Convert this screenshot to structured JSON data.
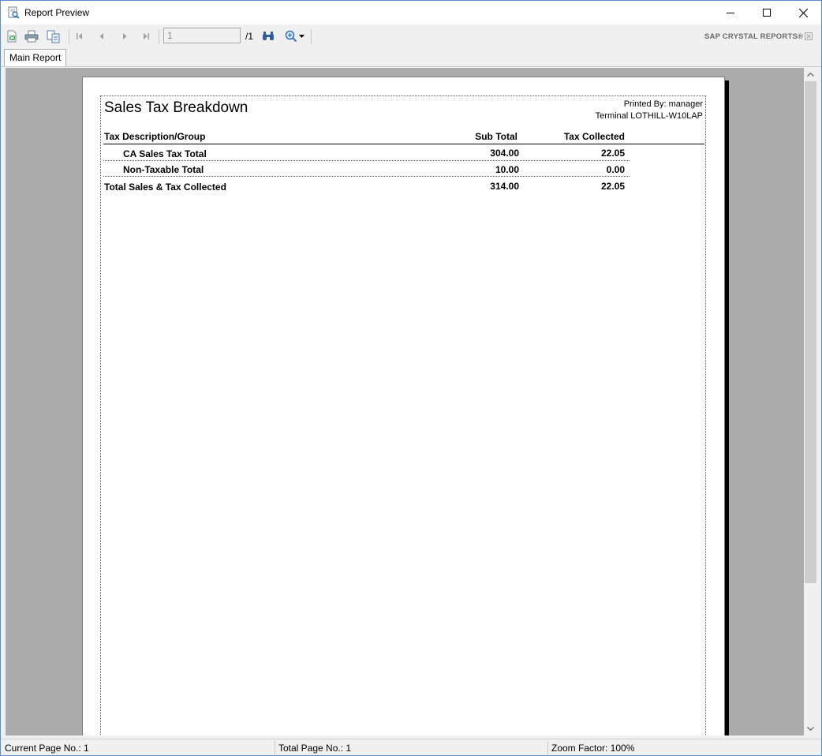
{
  "window": {
    "title": "Report Preview"
  },
  "toolbar": {
    "page_number_value": "1",
    "page_of": "/1",
    "brand": "SAP CRYSTAL REPORTS®"
  },
  "tabs": {
    "main_report": "Main Report"
  },
  "report": {
    "title": "Sales Tax Breakdown",
    "printed_by": "Printed By: manager",
    "terminal": "Terminal LOTHILL-W10LAP",
    "columns": {
      "description": "Tax Description/Group",
      "sub_total": "Sub Total",
      "tax_collected": "Tax Collected"
    },
    "rows": [
      {
        "description": "CA Sales Tax Total",
        "sub_total": "304.00",
        "tax_collected": "22.05"
      },
      {
        "description": "Non-Taxable Total",
        "sub_total": "10.00",
        "tax_collected": "0.00"
      }
    ],
    "total": {
      "description": "Total Sales & Tax Collected",
      "sub_total": "314.00",
      "tax_collected": "22.05"
    }
  },
  "status": {
    "current_page": "Current Page No.: 1",
    "total_page": "Total Page No.: 1",
    "zoom": "Zoom Factor: 100%"
  },
  "icons": [
    "report-preview-icon",
    "export-icon",
    "print-icon",
    "copy-icon",
    "first-page-icon",
    "previous-page-icon",
    "next-page-icon",
    "last-page-icon",
    "find-icon",
    "zoom-icon",
    "chevron-down-icon",
    "minimize-icon",
    "maximize-icon",
    "close-icon"
  ]
}
